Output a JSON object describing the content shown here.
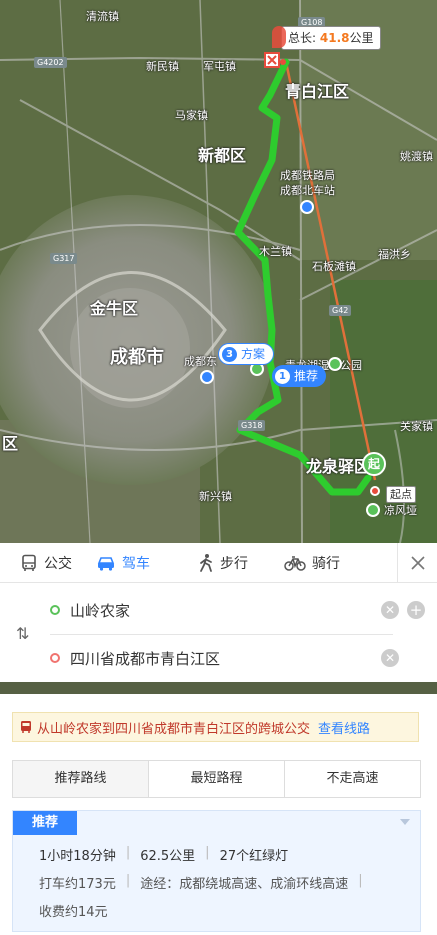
{
  "map": {
    "distance_prefix": "总长:",
    "distance_value": "41.8",
    "distance_unit": "公里",
    "places": [
      {
        "name": "清流镇",
        "cls": ""
      },
      {
        "name": "新民镇",
        "cls": ""
      },
      {
        "name": "军屯镇",
        "cls": ""
      },
      {
        "name": "青白江区",
        "cls": "big"
      },
      {
        "name": "马家镇",
        "cls": ""
      },
      {
        "name": "新都区",
        "cls": "big"
      },
      {
        "name": "成都铁路局",
        "cls": ""
      },
      {
        "name": "成都北车站",
        "cls": ""
      },
      {
        "name": "姚渡镇",
        "cls": ""
      },
      {
        "name": "木兰镇",
        "cls": ""
      },
      {
        "name": "石板滩镇",
        "cls": ""
      },
      {
        "name": "福洪乡",
        "cls": ""
      },
      {
        "name": "金牛区",
        "cls": "big"
      },
      {
        "name": "成都市",
        "cls": "city"
      },
      {
        "name": "成都东",
        "cls": ""
      },
      {
        "name": "青龙湖湿地公园",
        "cls": ""
      },
      {
        "name": "关家镇",
        "cls": ""
      },
      {
        "name": "龙泉驿区",
        "cls": "big"
      },
      {
        "name": "新兴镇",
        "cls": ""
      },
      {
        "name": "凉风垭",
        "cls": ""
      },
      {
        "name": "区",
        "cls": "big"
      }
    ],
    "road_badges": [
      "G108",
      "G4202",
      "G317",
      "G42",
      "G318"
    ],
    "start_badge": "起",
    "start_label": "起点",
    "plan_pill": {
      "num": "3",
      "label": "方案"
    },
    "rec_pill": {
      "num": "1",
      "label": "推荐"
    }
  },
  "tabs": {
    "bus": "公交",
    "drive": "驾车",
    "walk": "步行",
    "bike": "骑行"
  },
  "inputs": {
    "origin": "山岭农家",
    "destination": "四川省成都市青白江区"
  },
  "results": {
    "notice_text": "从山岭农家到四川省成都市青白江区的跨城公交",
    "notice_link": "查看线路",
    "strategies": [
      "推荐路线",
      "最短路程",
      "不走高速"
    ],
    "card": {
      "tag": "推荐",
      "duration": "1小时18分钟",
      "distance": "62.5公里",
      "lights": "27个红绿灯",
      "taxi": "打车约173元",
      "via": "途经：成都绕城高速、成渝环线高速",
      "toll": "收费约14元"
    }
  },
  "colors": {
    "accent": "#3385ff",
    "route": "#2ecc2e",
    "straight_line": "#e0703a",
    "distance_value": "#f47920"
  }
}
